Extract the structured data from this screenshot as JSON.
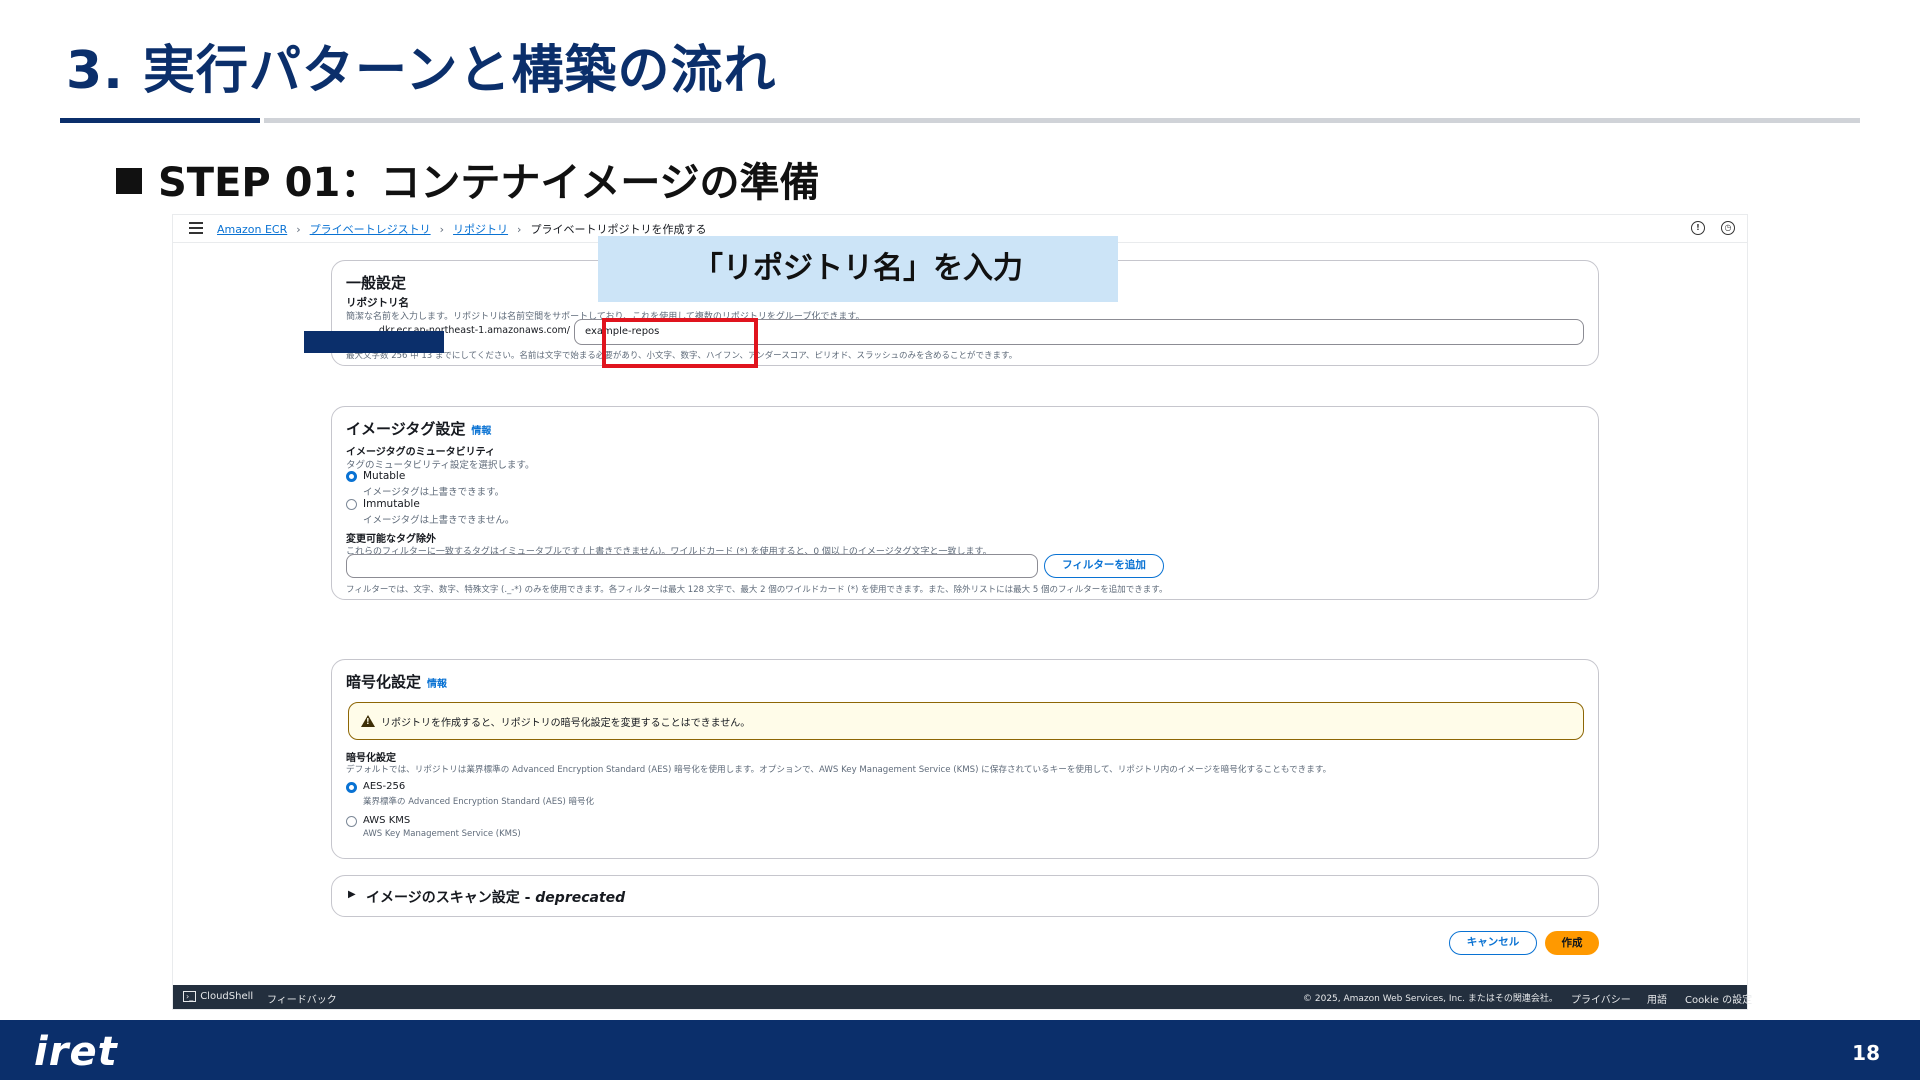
{
  "slide": {
    "title": "3.  実行パターンと構築の流れ",
    "step_heading": "STEP 01：コンテナイメージの準備",
    "callout": "「リポジトリ名」を入力",
    "logo": "iret",
    "page_number": "18",
    "colors": {
      "brand_navy": "#0b2f6b",
      "callout_bg": "#cce4f7",
      "highlight_red": "#e0141e"
    }
  },
  "console": {
    "breadcrumb": {
      "items": [
        "Amazon ECR",
        "プライベートレジストリ",
        "リポジトリ"
      ],
      "current": "プライベートリポジトリを作成する"
    },
    "top_icons": [
      "info-icon",
      "history-icon"
    ],
    "general": {
      "heading": "一般設定",
      "repo_label": "リポジトリ名",
      "repo_desc": "簡潔な名前を入力します。リポジトリは名前空間をサポートしており、これを使用して複数のリポジトリをグループ化できます。",
      "prefix": ".dkr.ecr.ap-northeast-1.amazonaws.com/",
      "repo_value": "example-repos",
      "constraint": "最大文字数 256 中 13 までにしてください。名前は文字で始まる必要があり、小文字、数字、ハイフン、アンダースコア、ピリオド、スラッシュのみを含めることができます。"
    },
    "tag": {
      "heading": "イメージタグ設定",
      "info": "情報",
      "mutability_label": "イメージタグのミュータビリティ",
      "mutability_desc": "タグのミュータビリティ設定を選択します。",
      "options": [
        {
          "label": "Mutable",
          "desc": "イメージタグは上書きできます。",
          "selected": true
        },
        {
          "label": "Immutable",
          "desc": "イメージタグは上書きできません。",
          "selected": false
        }
      ],
      "exclusion_label": "変更可能なタグ除外",
      "exclusion_desc": "これらのフィルターに一致するタグはイミュータブルです (上書きできません)。ワイルドカード (*) を使用すると、0 個以上のイメージタグ文字と一致します。",
      "filter_button": "フィルターを追加",
      "filter_hint": "フィルターでは、文字、数字、特殊文字 (._-*) のみを使用できます。各フィルターは最大 128 文字で、最大 2 個のワイルドカード (*) を使用できます。また、除外リストには最大 5 個のフィルターを追加できます。"
    },
    "encryption": {
      "heading": "暗号化設定",
      "info": "情報",
      "warning": "リポジトリを作成すると、リポジトリの暗号化設定を変更することはできません。",
      "label": "暗号化設定",
      "desc": "デフォルトでは、リポジトリは業界標準の Advanced Encryption Standard (AES) 暗号化を使用します。オプションで、AWS Key Management Service (KMS) に保存されているキーを使用して、リポジトリ内のイメージを暗号化することもできます。",
      "options": [
        {
          "label": "AES-256",
          "desc": "業界標準の Advanced Encryption Standard (AES) 暗号化",
          "selected": true
        },
        {
          "label": "AWS KMS",
          "desc": "AWS Key Management Service (KMS)",
          "selected": false
        }
      ]
    },
    "scan": {
      "heading": "イメージのスキャン設定 - ",
      "deprecated": "deprecated"
    },
    "actions": {
      "cancel": "キャンセル",
      "create": "作成"
    },
    "footer": {
      "cloudshell": "CloudShell",
      "feedback": "フィードバック",
      "copyright": "© 2025, Amazon Web Services, Inc. またはその関連会社。",
      "privacy": "プライバシー",
      "terms": "用語",
      "cookie": "Cookie の設定"
    }
  }
}
